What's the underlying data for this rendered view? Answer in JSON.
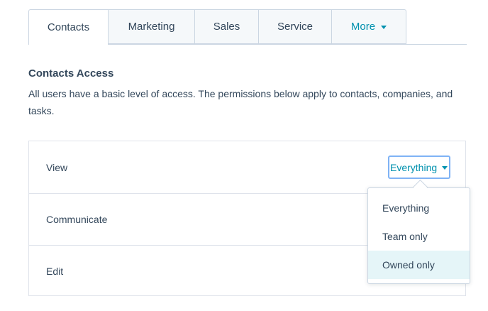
{
  "tabs": [
    {
      "label": "Contacts",
      "active": true
    },
    {
      "label": "Marketing",
      "active": false
    },
    {
      "label": "Sales",
      "active": false
    },
    {
      "label": "Service",
      "active": false
    },
    {
      "label": "More",
      "active": false
    }
  ],
  "section": {
    "title": "Contacts Access",
    "description": "All users have a basic level of access. The permissions below apply to contacts, companies, and tasks."
  },
  "permissions": [
    {
      "label": "View"
    },
    {
      "label": "Communicate"
    },
    {
      "label": "Edit"
    }
  ],
  "view_select": {
    "selected": "Everything",
    "options": [
      "Everything",
      "Team only",
      "Owned only"
    ],
    "highlighted": "Owned only"
  },
  "colors": {
    "accent": "#0091ae",
    "text": "#33475b",
    "border": "#cbd6e2",
    "focus_ring": "#7fb3f5",
    "option_hover": "#e5f5f8"
  },
  "icons": {
    "more_caret": "chevron-down-icon",
    "select_caret": "chevron-down-icon"
  }
}
